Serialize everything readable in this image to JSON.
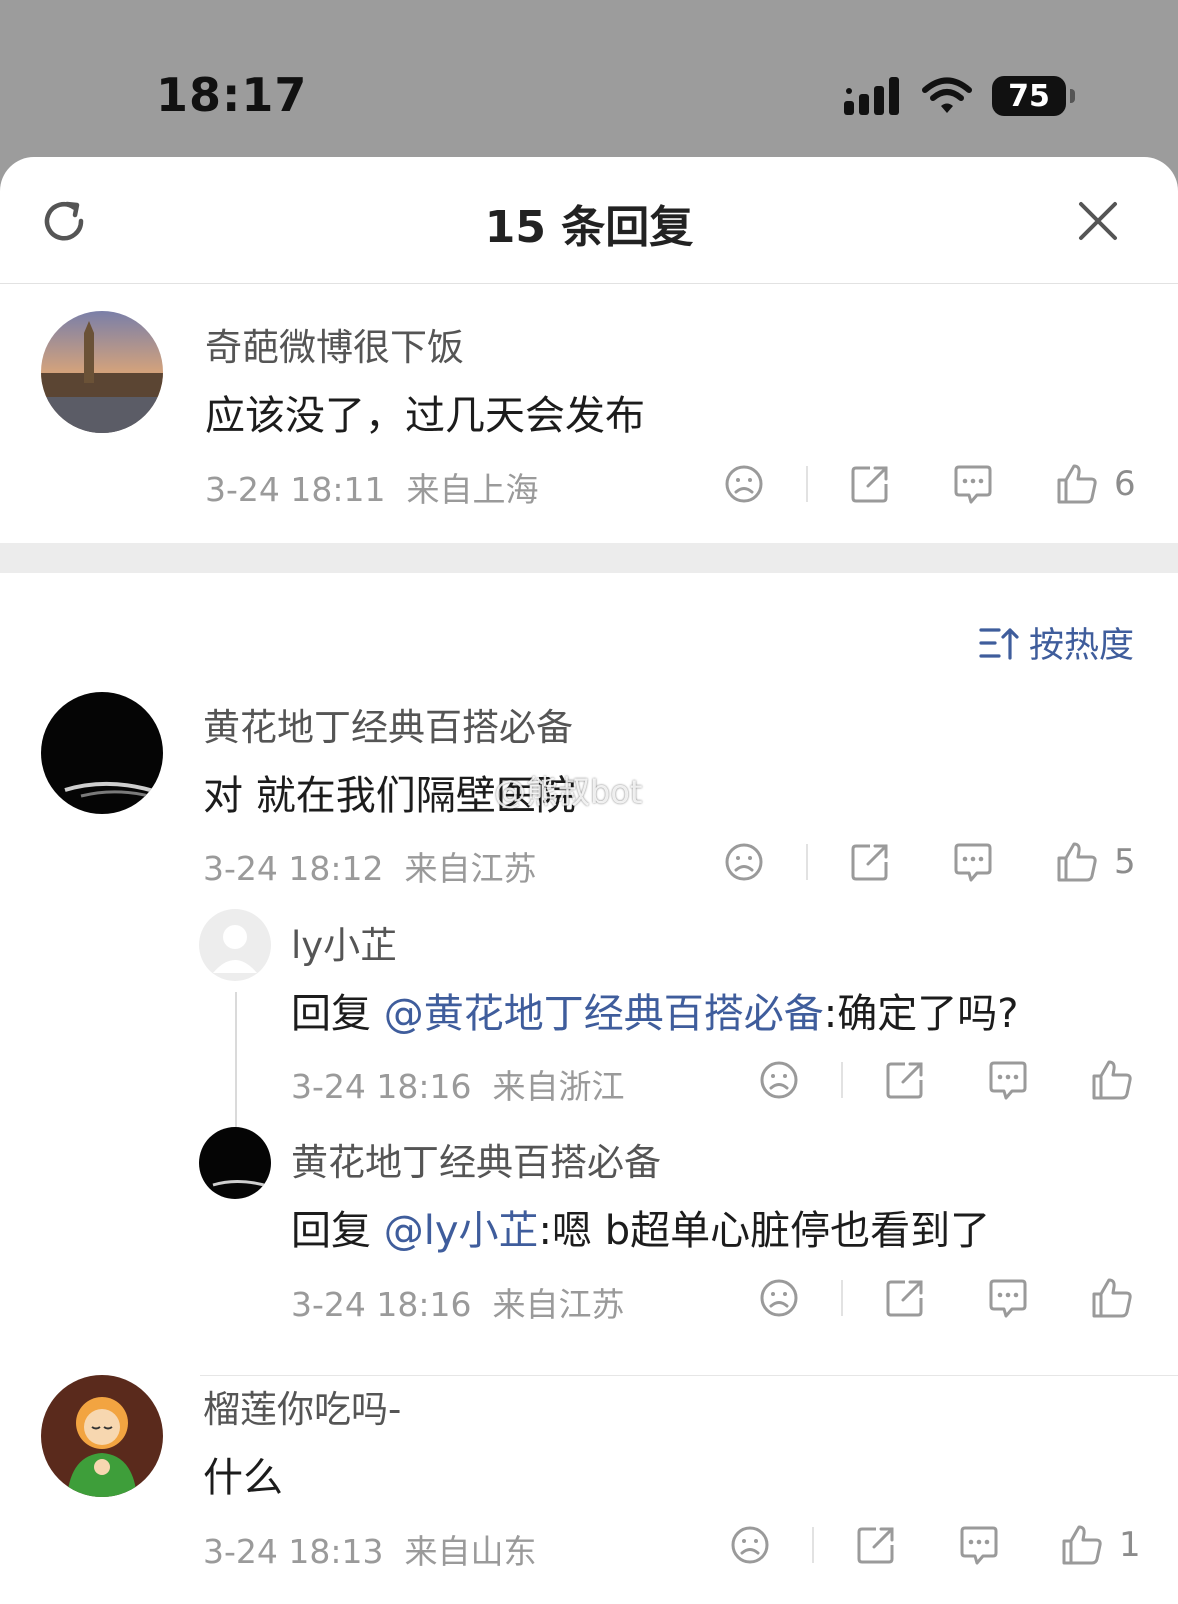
{
  "status_bar": {
    "time": "18:17",
    "battery": "75"
  },
  "header": {
    "title": "15 条回复"
  },
  "root_comment": {
    "name": "奇葩微博很下饭",
    "text": "应该没了，过几天会发布",
    "time": "3-24 18:11",
    "location": "来自上海",
    "likes": "6"
  },
  "sort": {
    "label": "按热度"
  },
  "comments": [
    {
      "name": "黄花地丁经典百搭必备",
      "text": "对 就在我们隔壁医院",
      "time": "3-24 18:12",
      "location": "来自江苏",
      "likes": "5",
      "replies": [
        {
          "name": "ly小芷",
          "prefix": "回复 ",
          "mention": "@黄花地丁经典百搭必备",
          "text": ":确定了吗?",
          "time": "3-24 18:16",
          "location": "来自浙江"
        },
        {
          "name": "黄花地丁经典百搭必备",
          "prefix": "回复 ",
          "mention": "@ly小芷",
          "text": ":嗯 b超单心脏停也看到了",
          "time": "3-24 18:16",
          "location": "来自江苏"
        }
      ]
    },
    {
      "name": "榴莲你吃吗-",
      "text": "什么",
      "time": "3-24 18:13",
      "location": "来自山东",
      "likes": "1"
    }
  ],
  "watermark": "@熊叔bot",
  "colors": {
    "link": "#3f5d9c",
    "meta": "#9a9a9a",
    "status_bg": "#9c9c9c"
  }
}
